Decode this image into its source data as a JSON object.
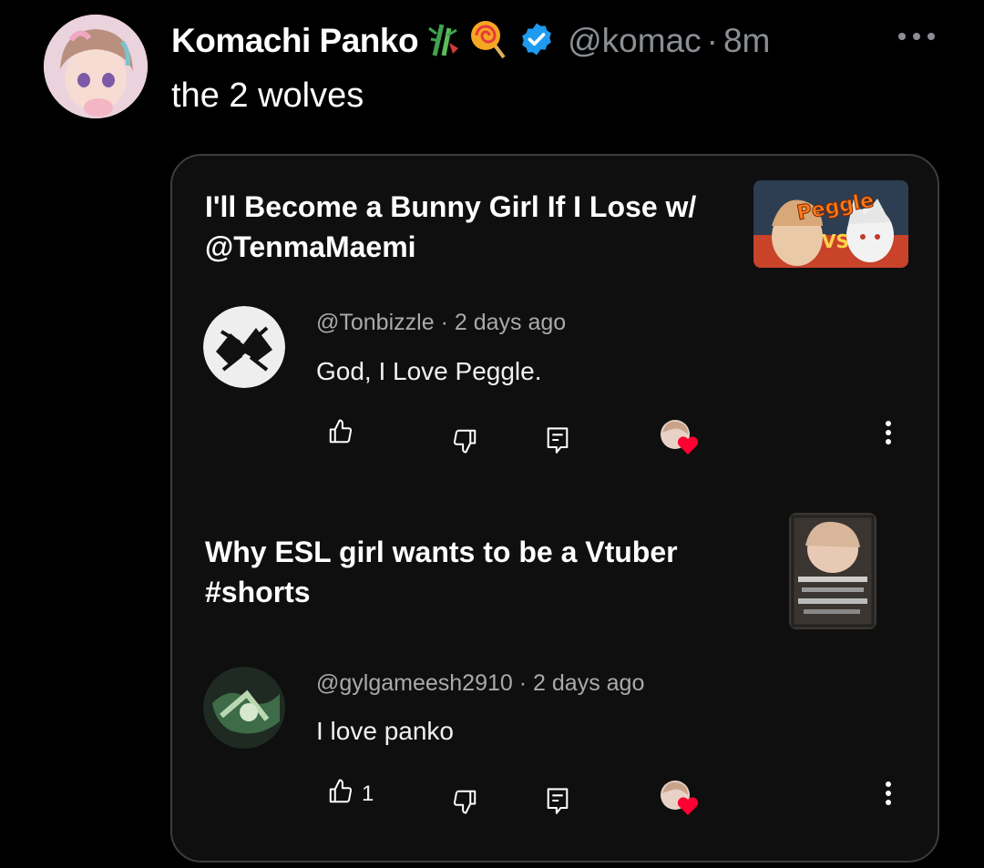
{
  "post": {
    "author_name": "Komachi Panko",
    "handle": "@komac",
    "separator": "·",
    "time": "8m",
    "text": "the 2 wolves"
  },
  "card": {
    "comments": [
      {
        "video_title": "I'll Become a Bunny Girl If I Lose w/ @TenmaMaemi",
        "thumbnail_text": "Peggle",
        "username": "@Tonbizzle",
        "age": "2 days ago",
        "text": "God, I Love Peggle.",
        "like_count": ""
      },
      {
        "video_title": "Why ESL girl wants to be a Vtuber #shorts",
        "username": "@gylgameesh2910",
        "age": "2 days ago",
        "text": "I love panko",
        "like_count": "1"
      }
    ]
  },
  "colors": {
    "background": "#000000",
    "card_background": "#0f0f0f",
    "card_border": "#3a3d41",
    "muted_text": "#8b8f94",
    "verified_blue": "#1d9bf0",
    "heart_red": "#ff0033"
  },
  "icons": [
    "bamboo-emoji-icon",
    "lollipop-emoji-icon",
    "verified-badge-icon",
    "more-dots-icon",
    "thumbs-up-icon",
    "thumbs-down-icon",
    "reply-icon",
    "creator-heart-icon",
    "kebab-menu-icon"
  ]
}
